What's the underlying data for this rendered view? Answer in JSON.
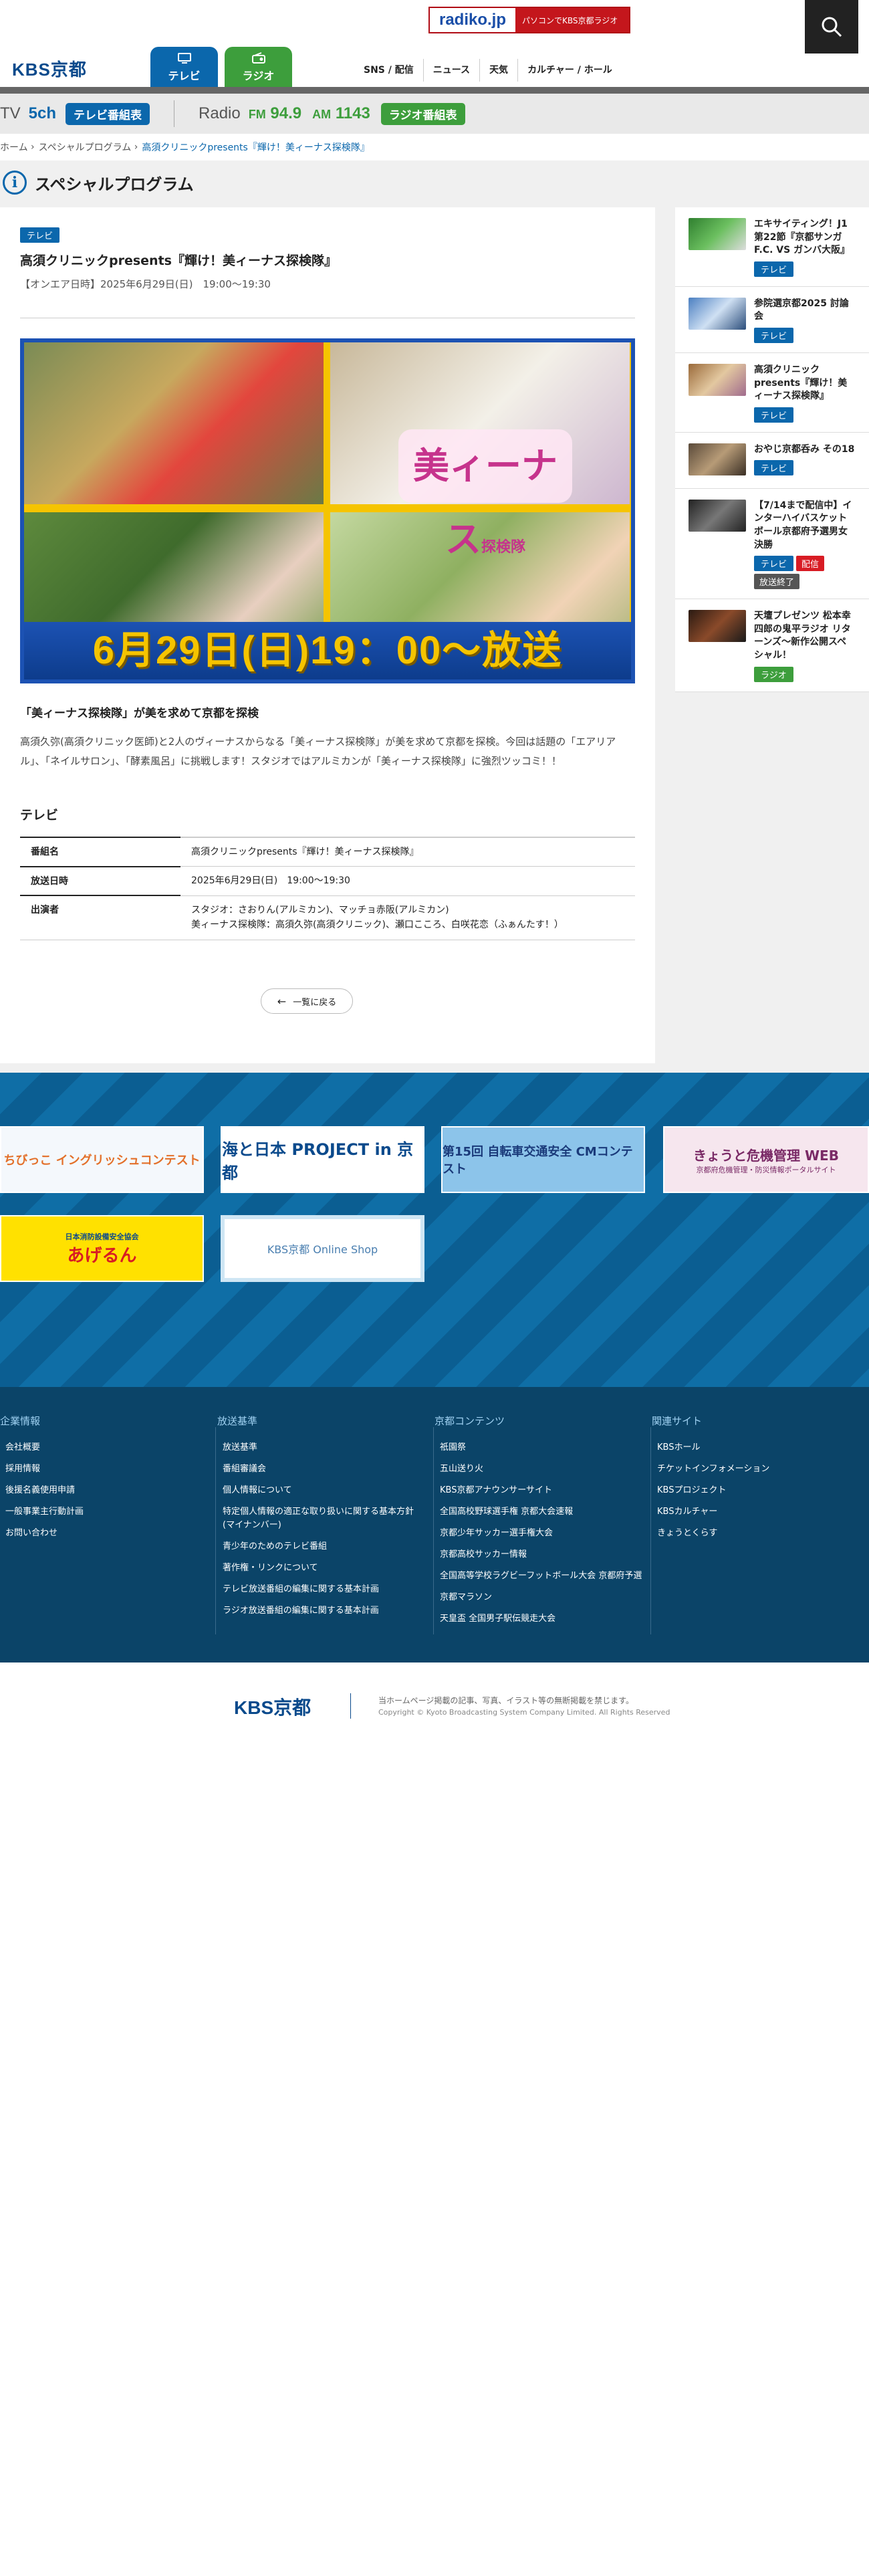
{
  "header": {
    "radiko": {
      "logo": "radiko.jp",
      "message": "パソコンでKBS京都ラジオ"
    },
    "site_logo": "KBS京都",
    "tabs": [
      {
        "label": "テレビ"
      },
      {
        "label": "ラジオ"
      }
    ],
    "nav": [
      "SNS / 配信",
      "ニュース",
      "天気",
      "カルチャー / ホール"
    ]
  },
  "onair": {
    "tv_label": "TV",
    "tv_channel": "5ch",
    "tv_button": "テレビ番組表",
    "radio_label": "Radio",
    "fm_band": "FM",
    "fm_freq": "94.9",
    "am_band": "AM",
    "am_freq": "1143",
    "radio_button": "ラジオ番組表"
  },
  "breadcrumb": [
    "ホーム",
    "スペシャルプログラム",
    "高須クリニックpresents『輝け！美ィーナス探検隊』"
  ],
  "section_title": "スペシャルプログラム",
  "article": {
    "category": "テレビ",
    "title": "高須クリニックpresents『輝け！美ィーナス探検隊』",
    "onair": "【オンエア日時】2025年6月29日(日)　19:00〜19:30",
    "hero_logo": "美ィーナス",
    "hero_logo_sub": "探検隊",
    "hero_date": "6月29日(日)19：00〜放送",
    "lead": "「美ィーナス探検隊」が美を求めて京都を探検",
    "description": "高須久弥(高須クリニック医師)と2人のヴィーナスからなる「美ィーナス探検隊」が美を求めて京都を探検。今回は話題の「エアリアル」、「ネイルサロン」、「酵素風呂」に挑戦します！スタジオではアルミカンが「美ィーナス探検隊」に強烈ツッコミ！！",
    "table_heading": "テレビ",
    "table": [
      {
        "label": "番組名",
        "value": "高須クリニックpresents『輝け！美ィーナス探検隊』"
      },
      {
        "label": "放送日時",
        "value": "2025年6月29日(日)　19:00〜19:30"
      },
      {
        "label": "出演者",
        "value": "スタジオ：さおりん(アルミカン)、マッチョ赤阪(アルミカン)",
        "value2": "美ィーナス探検隊：高須久弥(高須クリニック)、瀬口こころ、白咲花恋（ふぁんたす！）"
      }
    ],
    "back_label": "一覧に戻る"
  },
  "sidebar": [
    {
      "title": "エキサイティング！J1 第22節『京都サンガF.C. VS ガンバ大阪』",
      "badges": [
        "テレビ"
      ],
      "thumb": "#3b8a3a"
    },
    {
      "title": "参院選京都2025 討論会",
      "badges": [
        "テレビ"
      ],
      "thumb": "#5d8fc7"
    },
    {
      "title": "高須クリニックpresents『輝け！美ィーナス探検隊』",
      "badges": [
        "テレビ"
      ],
      "thumb": "#c88a55"
    },
    {
      "title": "おやじ京都呑み その18",
      "badges": [
        "テレビ"
      ],
      "thumb": "#7a6652"
    },
    {
      "title": "【7/14まで配信中】インターハイバスケットボール京都府予選男女決勝",
      "badges": [
        "テレビ",
        "配信",
        "放送終了"
      ],
      "thumb": "#444444"
    },
    {
      "title": "天壇プレゼンツ 松本幸四郎の鬼平ラジオ リターンズ〜新作公開スペシャル！",
      "badges": [
        "ラジオ"
      ],
      "thumb": "#6b3b2a"
    }
  ],
  "banners": [
    {
      "label": "ちびっこ イングリッシュコンテスト"
    },
    {
      "label": "海と日本 PROJECT in 京都"
    },
    {
      "label": "第15回 自転車交通安全 CMコンテスト"
    },
    {
      "label": "きょうと危機管理 WEB",
      "sub": "京都府危機管理・防災情報ポータルサイト"
    },
    {
      "label": "あげるん",
      "sub": "日本消防設備安全協会"
    },
    {
      "label": "KBS京都 Online Shop"
    }
  ],
  "footer": {
    "columns": [
      {
        "title": "企業情報",
        "items": [
          "会社概要",
          "採用情報",
          "後援名義使用申請",
          "一般事業主行動計画",
          "お問い合わせ"
        ]
      },
      {
        "title": "放送基準",
        "items": [
          "放送基準",
          "番組審議会",
          "個人情報について",
          "特定個人情報の適正な取り扱いに関する基本方針(マイナンバー)",
          "青少年のためのテレビ番組",
          "著作権・リンクについて",
          "テレビ放送番組の編集に関する基本計画",
          "ラジオ放送番組の編集に関する基本計画"
        ]
      },
      {
        "title": "京都コンテンツ",
        "items": [
          "祇園祭",
          "五山送り火",
          "KBS京都アナウンサーサイト",
          "全国高校野球選手権 京都大会速報",
          "京都少年サッカー選手権大会",
          "京都高校サッカー情報",
          "全国高等学校ラグビーフットボール大会 京都府予選",
          "京都マラソン",
          "天皇盃 全国男子駅伝競走大会"
        ]
      },
      {
        "title": "関連サイト",
        "items": [
          "KBSホール",
          "チケットインフォメーション",
          "KBSプロジェクト",
          "KBSカルチャー",
          "きょうとくらす"
        ]
      }
    ],
    "logo": "KBS京都",
    "notice": "当ホームページ掲載の記事、写真、イラスト等の無断掲載を禁じます。",
    "copyright": "Copyright © Kyoto Broadcasting System Company Limited. All Rights Reserved"
  }
}
